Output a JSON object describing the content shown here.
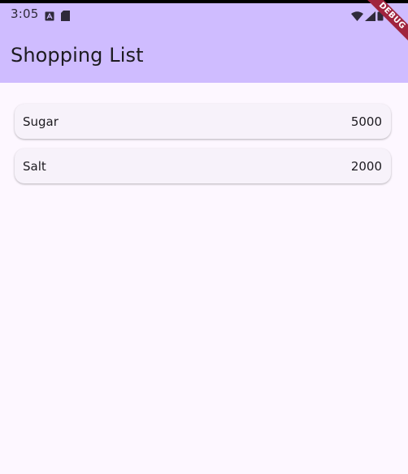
{
  "status_bar": {
    "time": "3:05",
    "left_icons": [
      "notification-a-icon",
      "sd-card-icon"
    ],
    "right_icons": [
      "wifi-icon",
      "signal-icon",
      "battery-icon"
    ]
  },
  "app_bar": {
    "title": "Shopping List",
    "background": "#cfbcff"
  },
  "debug_banner": {
    "label": "DEBUG",
    "color": "#a0243e"
  },
  "shopping_list": {
    "items": [
      {
        "name": "Sugar",
        "quantity": "5000"
      },
      {
        "name": "Salt",
        "quantity": "2000"
      }
    ]
  },
  "colors": {
    "page_background": "#fdf7ff",
    "card_background": "#f7f2fa"
  }
}
